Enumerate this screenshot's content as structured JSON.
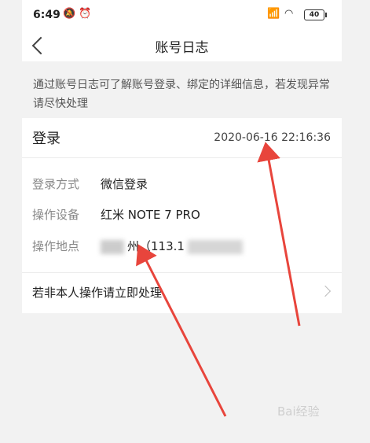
{
  "status_bar": {
    "time": "6:49",
    "battery": "40"
  },
  "nav": {
    "title": "账号日志"
  },
  "notice": {
    "text": "通过账号日志可了解账号登录、绑定的详细信息，若发现异常请尽快处理"
  },
  "card": {
    "label": "登录",
    "timestamp": "2020-06-16 22:16:36",
    "rows": [
      {
        "key": "登录方式",
        "value": "微信登录"
      },
      {
        "key": "操作设备",
        "value": "红米 NOTE 7 PRO"
      },
      {
        "key": "操作地点",
        "value_prefix": "州",
        "value_mid": "（113.1"
      }
    ],
    "action_label": "若非本人操作请立即处理"
  },
  "watermark": "Bai经验",
  "colors": {
    "arrow": "#e8453c",
    "card_bg": "#ffffff",
    "page_bg": "#f2f2f2"
  }
}
